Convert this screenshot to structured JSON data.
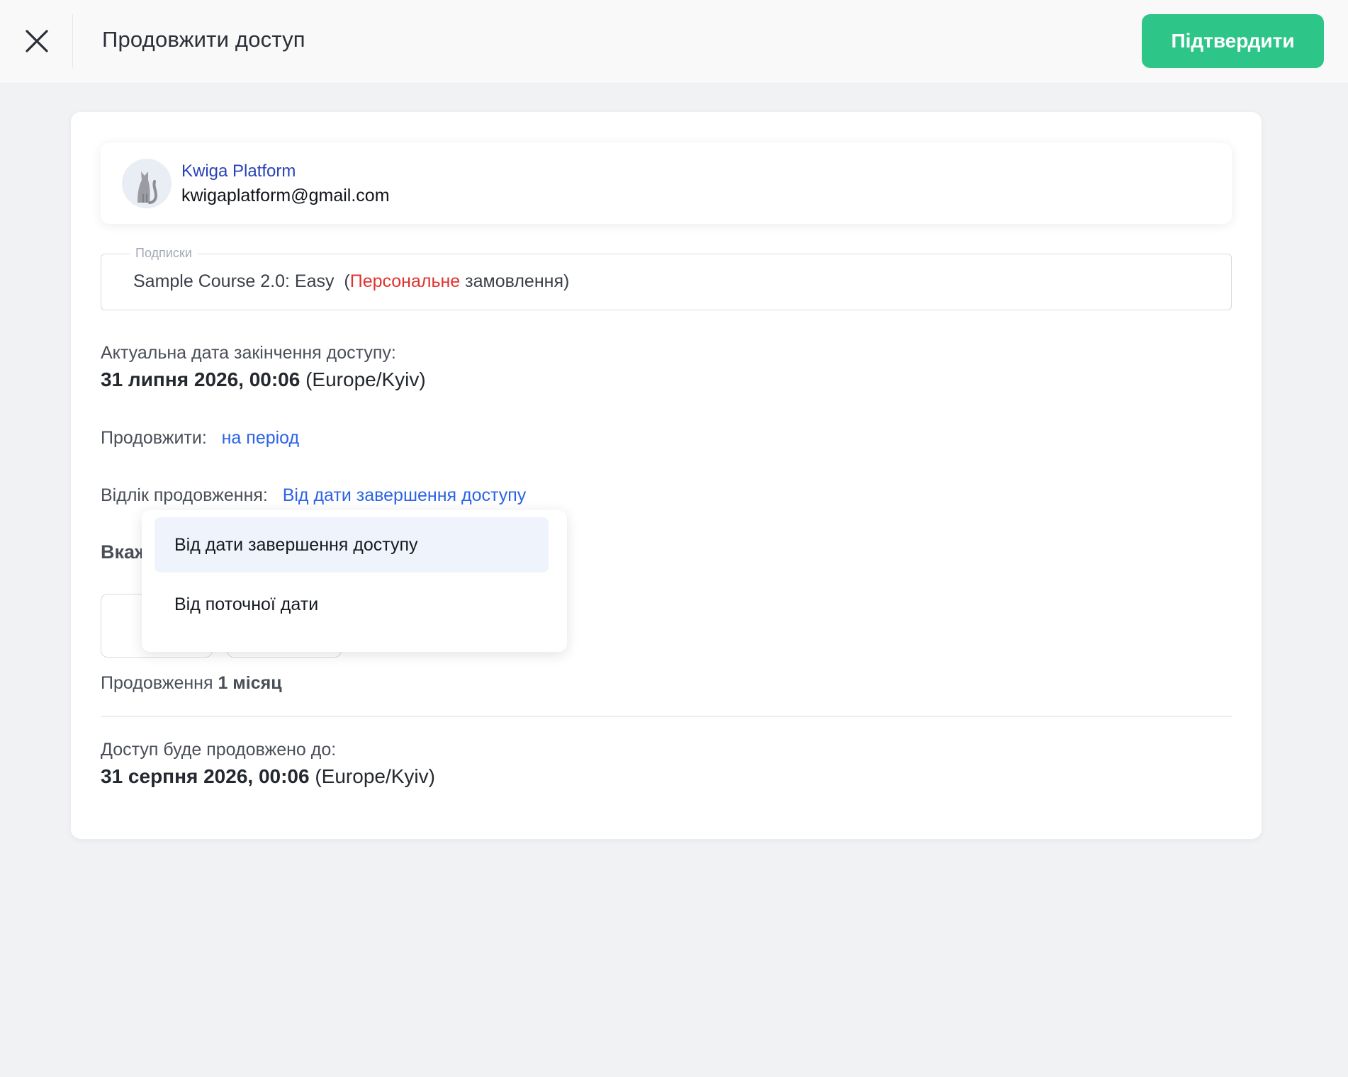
{
  "header": {
    "title": "Продовжити доступ",
    "confirm_label": "Підтвердити"
  },
  "user": {
    "name": "Kwiga Platform",
    "email": "kwigaplatform@gmail.com"
  },
  "subscription": {
    "legend": "Подписки",
    "course": "Sample Course 2.0: Easy",
    "paren_open": "(",
    "order_type": "Персональне",
    "order_word": "замовлення",
    "paren_close": ")"
  },
  "current_expiry": {
    "label": "Актуальна дата закінчення доступу:",
    "date": "31 липня 2026, 00:06",
    "tz": "(Europe/Kyiv)"
  },
  "extend": {
    "label": "Продовжити:",
    "value": "на період"
  },
  "origin": {
    "label": "Відлік продовження:",
    "value": "Від дати завершення доступу"
  },
  "specify": {
    "label_visible": "Вкаж"
  },
  "duration": {
    "prefix": "Продовження",
    "value": "1 місяц"
  },
  "new_expiry": {
    "label": "Доступ буде продовжено до:",
    "date": "31 серпня 2026, 00:06",
    "tz": "(Europe/Kyiv)"
  },
  "dropdown": {
    "options": [
      {
        "label": "Від дати завершення доступу",
        "selected": true
      },
      {
        "label": "Від поточної дати",
        "selected": false
      }
    ]
  },
  "colors": {
    "accent_green": "#2ec588",
    "link_blue": "#2c63e5",
    "name_blue": "#2742b8",
    "red": "#e0332e"
  }
}
